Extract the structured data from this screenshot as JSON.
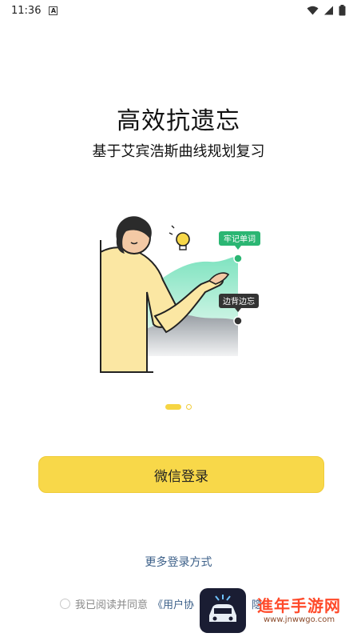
{
  "status_bar": {
    "time": "11:36",
    "badge": "A"
  },
  "onboarding": {
    "title": "高效抗遗忘",
    "subtitle": "基于艾宾浩斯曲线规划复习",
    "tag_remember": "牢记单词",
    "tag_forget": "边背边忘",
    "page_indicator": {
      "current": 1,
      "total": 2
    }
  },
  "login": {
    "wechat_button": "微信登录",
    "more_options": "更多登录方式"
  },
  "agreement": {
    "prefix": "我已阅读并同意",
    "user_agreement": "《用户协",
    "privacy_partial": "隐"
  },
  "watermark": {
    "brand": "進年手游网",
    "url": "www.jnwwgo.com"
  },
  "colors": {
    "accent": "#f8d849",
    "link": "#3b5f88",
    "green_tag": "#2bb673",
    "dark_tag": "#333333"
  }
}
